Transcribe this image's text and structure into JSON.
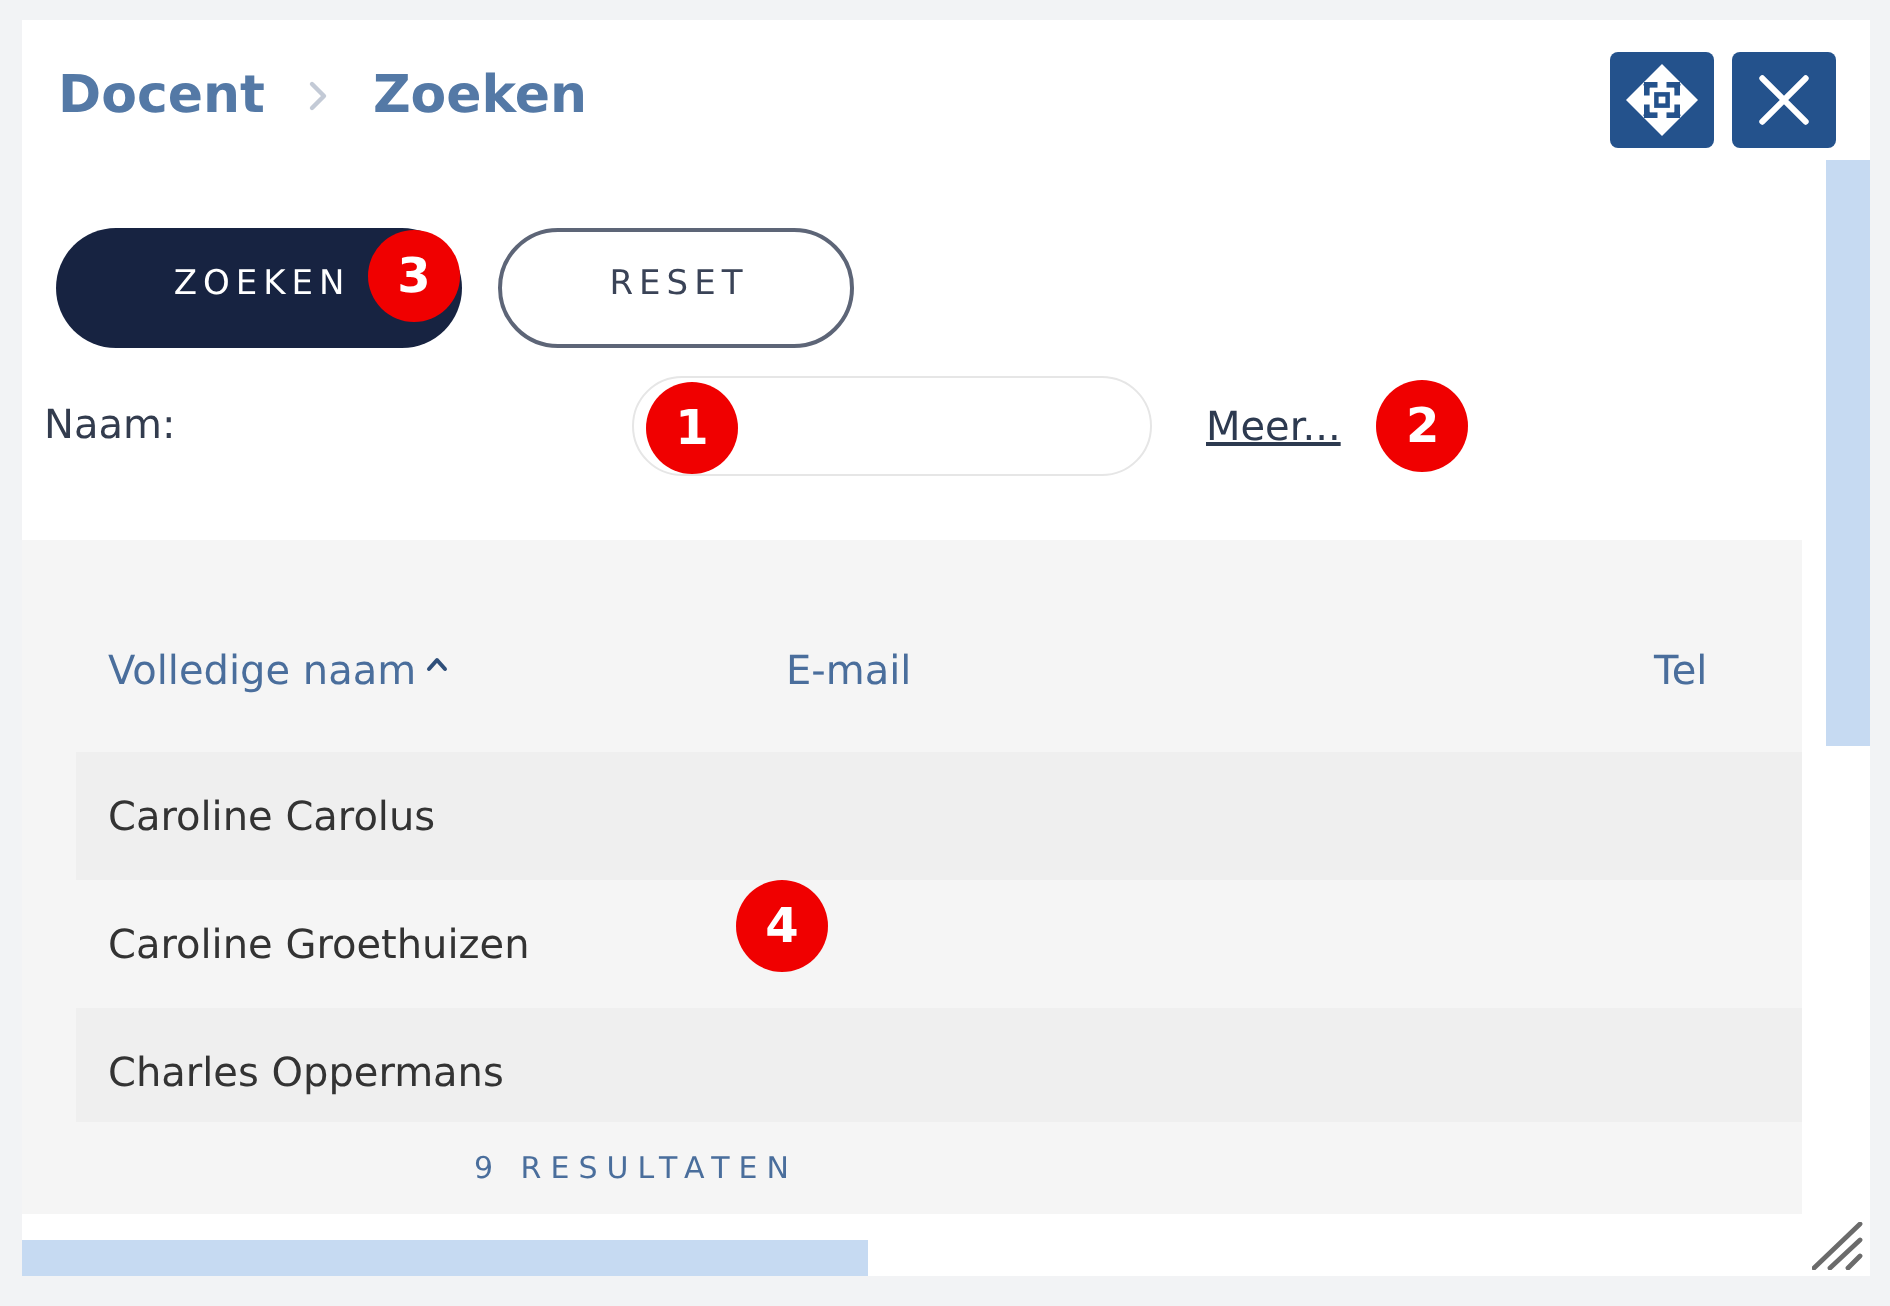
{
  "breadcrumb": [
    {
      "label": "Docent"
    },
    {
      "label": "Zoeken"
    }
  ],
  "actions": [
    {
      "kind": "primary",
      "label": "ZOEKEN",
      "callout": "3"
    },
    {
      "kind": "outline",
      "label": "RESET"
    }
  ],
  "filter": {
    "label": "Naam:",
    "field_callout": "1",
    "more_link": "Meer...",
    "link_callout": "2"
  },
  "table": {
    "columns": [
      {
        "label": "Volledige naam",
        "sorted": true
      },
      {
        "label": "E-mail",
        "sorted": false
      },
      {
        "label": "Tel",
        "sorted": false
      }
    ],
    "rows": [
      {
        "cells": [
          "Caroline Carolus"
        ]
      },
      {
        "cells": [
          "Caroline Groethuizen"
        ]
      },
      {
        "cells": [
          "Charles Oppermans"
        ]
      }
    ],
    "result_count": "9 RESULTATEN",
    "callout": "4"
  }
}
